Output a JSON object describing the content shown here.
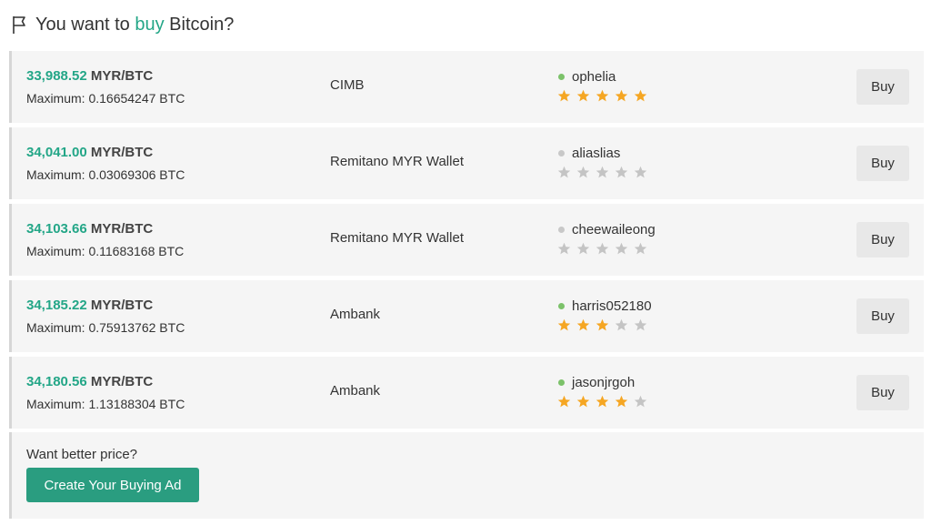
{
  "header": {
    "prefix": "You want to",
    "action": "buy",
    "suffix": "Bitcoin?",
    "icon": "flag-icon"
  },
  "colors": {
    "accent": "#23a687",
    "online": "#7cc26a",
    "offline": "#c8c8c8",
    "star_filled": "#f5a623",
    "star_empty": "#c4c4c4",
    "create_button": "#2a9d80"
  },
  "offers": [
    {
      "price": "33,988.52",
      "unit": "MYR/BTC",
      "max_label": "Maximum:",
      "max_value": "0.16654247 BTC",
      "bank": "CIMB",
      "seller": "ophelia",
      "online": true,
      "rating": 5,
      "button": "Buy"
    },
    {
      "price": "34,041.00",
      "unit": "MYR/BTC",
      "max_label": "Maximum:",
      "max_value": "0.03069306 BTC",
      "bank": "Remitano MYR Wallet",
      "seller": "aliaslias",
      "online": false,
      "rating": 0,
      "button": "Buy"
    },
    {
      "price": "34,103.66",
      "unit": "MYR/BTC",
      "max_label": "Maximum:",
      "max_value": "0.11683168 BTC",
      "bank": "Remitano MYR Wallet",
      "seller": "cheewaileong",
      "online": false,
      "rating": 0,
      "button": "Buy"
    },
    {
      "price": "34,185.22",
      "unit": "MYR/BTC",
      "max_label": "Maximum:",
      "max_value": "0.75913762 BTC",
      "bank": "Ambank",
      "seller": "harris052180",
      "online": true,
      "rating": 3,
      "button": "Buy"
    },
    {
      "price": "34,180.56",
      "unit": "MYR/BTC",
      "max_label": "Maximum:",
      "max_value": "1.13188304 BTC",
      "bank": "Ambank",
      "seller": "jasonjrgoh",
      "online": true,
      "rating": 4,
      "button": "Buy"
    }
  ],
  "better_price": {
    "prompt": "Want better price?",
    "button": "Create Your Buying Ad"
  }
}
